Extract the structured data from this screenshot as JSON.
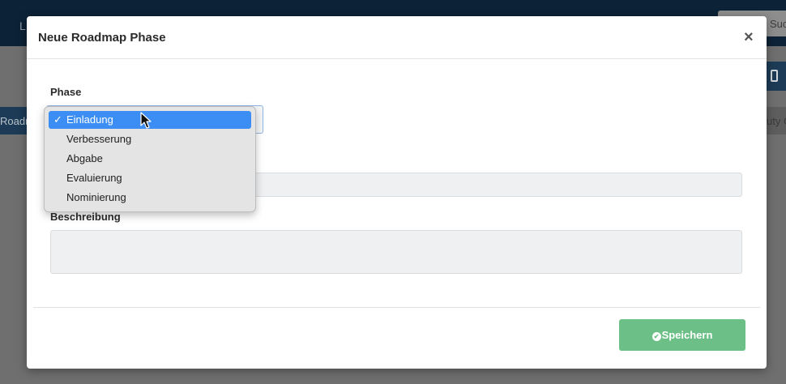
{
  "background": {
    "nav_fragment": "L",
    "top_button_label": "Suc",
    "active_tab_label": "Roadm",
    "right_tab_label": "uty C"
  },
  "modal": {
    "title": "Neue Roadmap Phase",
    "close_symbol": "×",
    "phase_label": "Phase",
    "description_label": "Beschreibung",
    "save_label": "Speichern"
  },
  "dropdown": {
    "options": [
      "Einladung",
      "Verbesserung",
      "Abgabe",
      "Evaluierung",
      "Nominierung"
    ],
    "selected": "Einladung",
    "check_symbol": "✓"
  },
  "colors": {
    "primary_dark": "#0c2236",
    "selected_option": "#3d8ef4",
    "save_button": "#6cc087"
  },
  "icons": {
    "close": "close-icon",
    "check": "checkmark-icon",
    "save": "check-circle-icon",
    "device": "tablet-icon",
    "cursor": "mouse-pointer-icon"
  }
}
